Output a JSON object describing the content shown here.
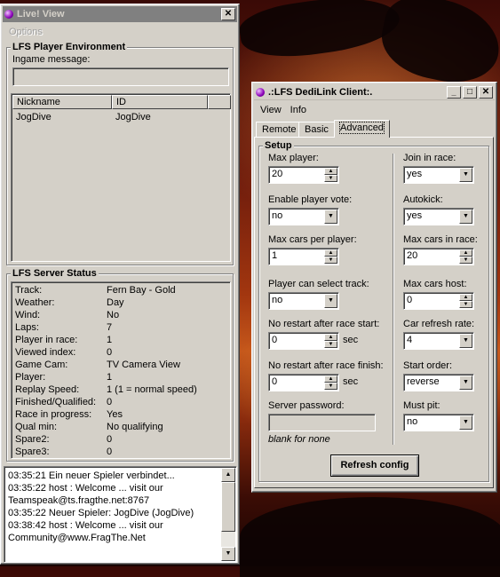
{
  "liveview": {
    "title": "Live! View",
    "menu_options": "Options",
    "player_env": {
      "group_title": "LFS Player Environment",
      "ingame_label": "Ingame message:",
      "ingame_value": "",
      "columns": [
        "Nickname",
        "ID"
      ],
      "players": [
        {
          "nickname": "JogDive",
          "id": "JogDive"
        }
      ]
    },
    "server_status": {
      "group_title": "LFS Server Status",
      "rows": [
        {
          "k": "Track:",
          "v": "Fern Bay - Gold"
        },
        {
          "k": "Weather:",
          "v": "Day"
        },
        {
          "k": "Wind:",
          "v": "No"
        },
        {
          "k": "Laps:",
          "v": "7"
        },
        {
          "k": "Player in race:",
          "v": "1"
        },
        {
          "k": "Viewed index:",
          "v": "0"
        },
        {
          "k": "Game Cam:",
          "v": "TV Camera View"
        },
        {
          "k": "Player:",
          "v": "1"
        },
        {
          "k": "Replay Speed:",
          "v": "1  (1 = normal speed)"
        },
        {
          "k": "Finished/Qualified:",
          "v": "0"
        },
        {
          "k": "Race in progress:",
          "v": "Yes"
        },
        {
          "k": "Qual min:",
          "v": "No qualifying"
        },
        {
          "k": "Spare2:",
          "v": "0"
        },
        {
          "k": "Spare3:",
          "v": "0"
        }
      ]
    },
    "log": [
      "03:35:21 Ein neuer Spieler verbindet...",
      "03:35:22 host : Welcome ... visit our",
      "Teamspeak@ts.fragthe.net:8767",
      "03:35:22 Neuer Spieler: JogDive (JogDive)",
      "03:38:42 host : Welcome ... visit our",
      "Community@www.FragThe.Net"
    ]
  },
  "dedilink": {
    "title": ".:LFS DediLink Client:.",
    "menu": [
      "View",
      "Info"
    ],
    "tabs": [
      "Remote",
      "Basic",
      "Advanced"
    ],
    "setup_title": "Setup",
    "left": {
      "max_player": {
        "label": "Max player:",
        "value": "20"
      },
      "player_vote": {
        "label": "Enable player vote:",
        "value": "no"
      },
      "max_cars_per_player": {
        "label": "Max cars per player:",
        "value": "1"
      },
      "select_track": {
        "label": "Player can select track:",
        "value": "no"
      },
      "no_restart_start": {
        "label": "No restart after race start:",
        "value": "0",
        "unit": "sec"
      },
      "no_restart_finish": {
        "label": "No restart after race finish:",
        "value": "0",
        "unit": "sec"
      },
      "server_password": {
        "label": "Server password:",
        "value": "",
        "hint": "blank for none"
      }
    },
    "right": {
      "join_in_race": {
        "label": "Join in race:",
        "value": "yes"
      },
      "autokick": {
        "label": "Autokick:",
        "value": "yes"
      },
      "max_cars_in_race": {
        "label": "Max cars in race:",
        "value": "20"
      },
      "max_cars_host": {
        "label": "Max cars host:",
        "value": "0"
      },
      "car_refresh_rate": {
        "label": "Car refresh rate:",
        "value": "4"
      },
      "start_order": {
        "label": "Start order:",
        "value": "reverse"
      },
      "must_pit": {
        "label": "Must pit:",
        "value": "no"
      }
    },
    "refresh_button": "Refresh config"
  }
}
